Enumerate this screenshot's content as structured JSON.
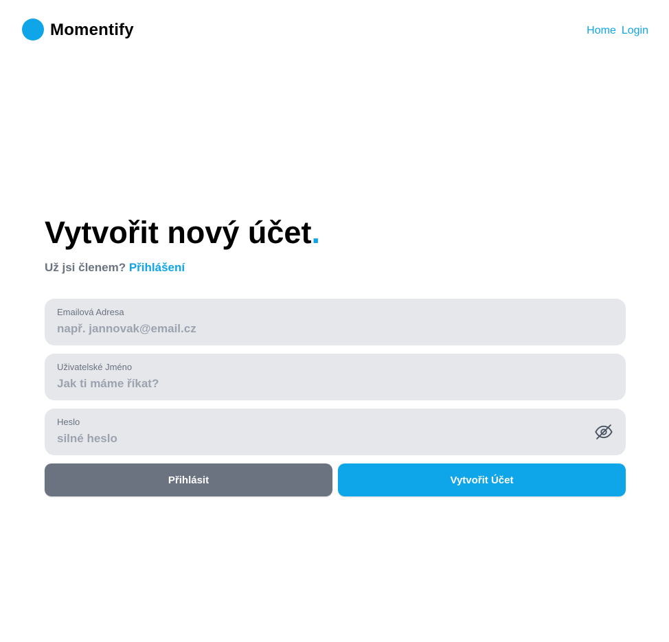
{
  "header": {
    "brand": "Momentify",
    "nav": [
      {
        "label": "Home"
      },
      {
        "label": "Login"
      }
    ]
  },
  "main": {
    "title": "Vytvořit nový účet",
    "title_dot": ".",
    "subtitle": "Už jsi členem?",
    "subtitle_link": "Přihlášení",
    "fields": {
      "email": {
        "label": "Emailová Adresa",
        "placeholder": "např. jannovak@email.cz",
        "value": ""
      },
      "username": {
        "label": "Uživatelské Jméno",
        "placeholder": "Jak ti máme říkat?",
        "value": ""
      },
      "password": {
        "label": "Heslo",
        "placeholder": "silné heslo",
        "value": "",
        "toggle_icon": "eye-off-icon"
      }
    },
    "buttons": {
      "login": "Přihlásit",
      "create": "Vytvořit Účet"
    }
  },
  "colors": {
    "accent": "#0ea5e9",
    "secondary_button": "#6b7280",
    "field_bg": "#e5e7eb"
  }
}
